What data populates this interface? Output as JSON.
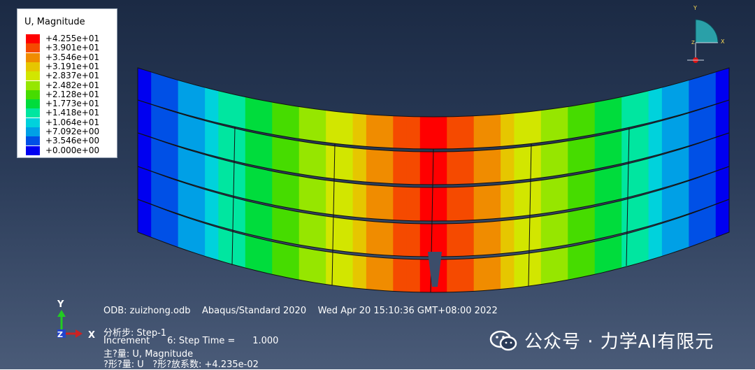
{
  "legend": {
    "title": "U, Magnitude",
    "entries": [
      {
        "label": "+4.255e+01",
        "color": "#ff0000"
      },
      {
        "label": "+3.901e+01",
        "color": "#f54a00"
      },
      {
        "label": "+3.546e+01",
        "color": "#f08c00"
      },
      {
        "label": "+3.191e+01",
        "color": "#e6c600"
      },
      {
        "label": "+2.837e+01",
        "color": "#d2e600"
      },
      {
        "label": "+2.482e+01",
        "color": "#96e600"
      },
      {
        "label": "+2.128e+01",
        "color": "#46dc00"
      },
      {
        "label": "+1.773e+01",
        "color": "#00dc3c"
      },
      {
        "label": "+1.418e+01",
        "color": "#00e6a0"
      },
      {
        "label": "+1.064e+01",
        "color": "#00d2dc"
      },
      {
        "label": "+7.092e+00",
        "color": "#00a0e6"
      },
      {
        "label": "+3.546e+00",
        "color": "#0050e6"
      },
      {
        "label": "+0.000e+00",
        "color": "#0000f0"
      }
    ]
  },
  "triad_small": {
    "y": "Y",
    "x": "X",
    "z": "Z"
  },
  "triad_main": {
    "y": "Y",
    "x": "X",
    "z": "Z"
  },
  "info": {
    "line1": "ODB: zuizhong.odb    Abaqus/Standard 2020    Wed Apr 20 15:10:36 GMT+08:00 2022",
    "line2": "分析步: Step-1",
    "line3": "Increment      6: Step Time =      1.000",
    "line4": "主?量: U, Magnitude",
    "line5": "?形?量: U   ?形?放系数: +4.235e-02"
  },
  "watermark": {
    "text": "公众号 · 力学AI有限元",
    "icon": "wechat-icon"
  }
}
